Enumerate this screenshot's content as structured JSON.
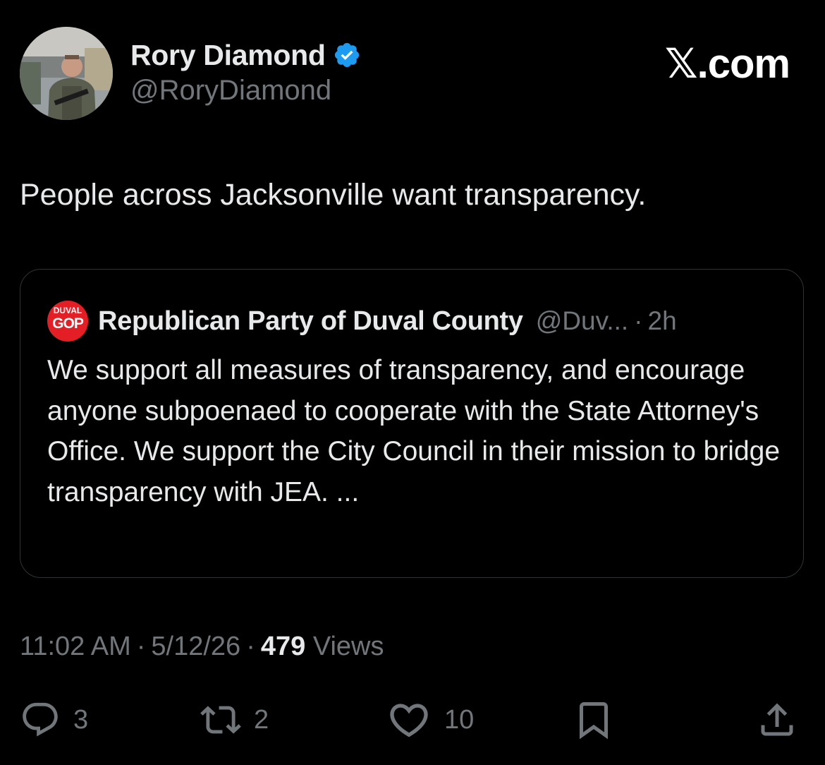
{
  "author": {
    "name": "Rory Diamond",
    "handle": "@RoryDiamond",
    "verified": true,
    "avatar": "profile-photo"
  },
  "brand": "𝕏.com",
  "tweet": {
    "text": "People across Jacksonville want transparency."
  },
  "quote": {
    "logo_line1": "DUVAL",
    "logo_line2": "GOP",
    "logo_color": "#e31e24",
    "name": "Republican Party of Duval County",
    "handle": "@Duv...",
    "separator": "·",
    "time": "2h",
    "body": "We support all measures of transparency, and encourage anyone subpoenaed to cooperate with the State Attorney's Office. We support the City Council in their mission to bridge transparency with JEA. ..."
  },
  "meta": {
    "time": "11:02 AM",
    "sep1": "·",
    "date": "5/12/26",
    "sep2": "·",
    "views_count": "479",
    "views_label": "Views"
  },
  "actions": {
    "reply_count": "3",
    "repost_count": "2",
    "like_count": "10"
  },
  "colors": {
    "background": "#000000",
    "text": "#e7e9ea",
    "muted": "#71767b",
    "verified": "#1d9bf0",
    "border": "#2f3336"
  }
}
